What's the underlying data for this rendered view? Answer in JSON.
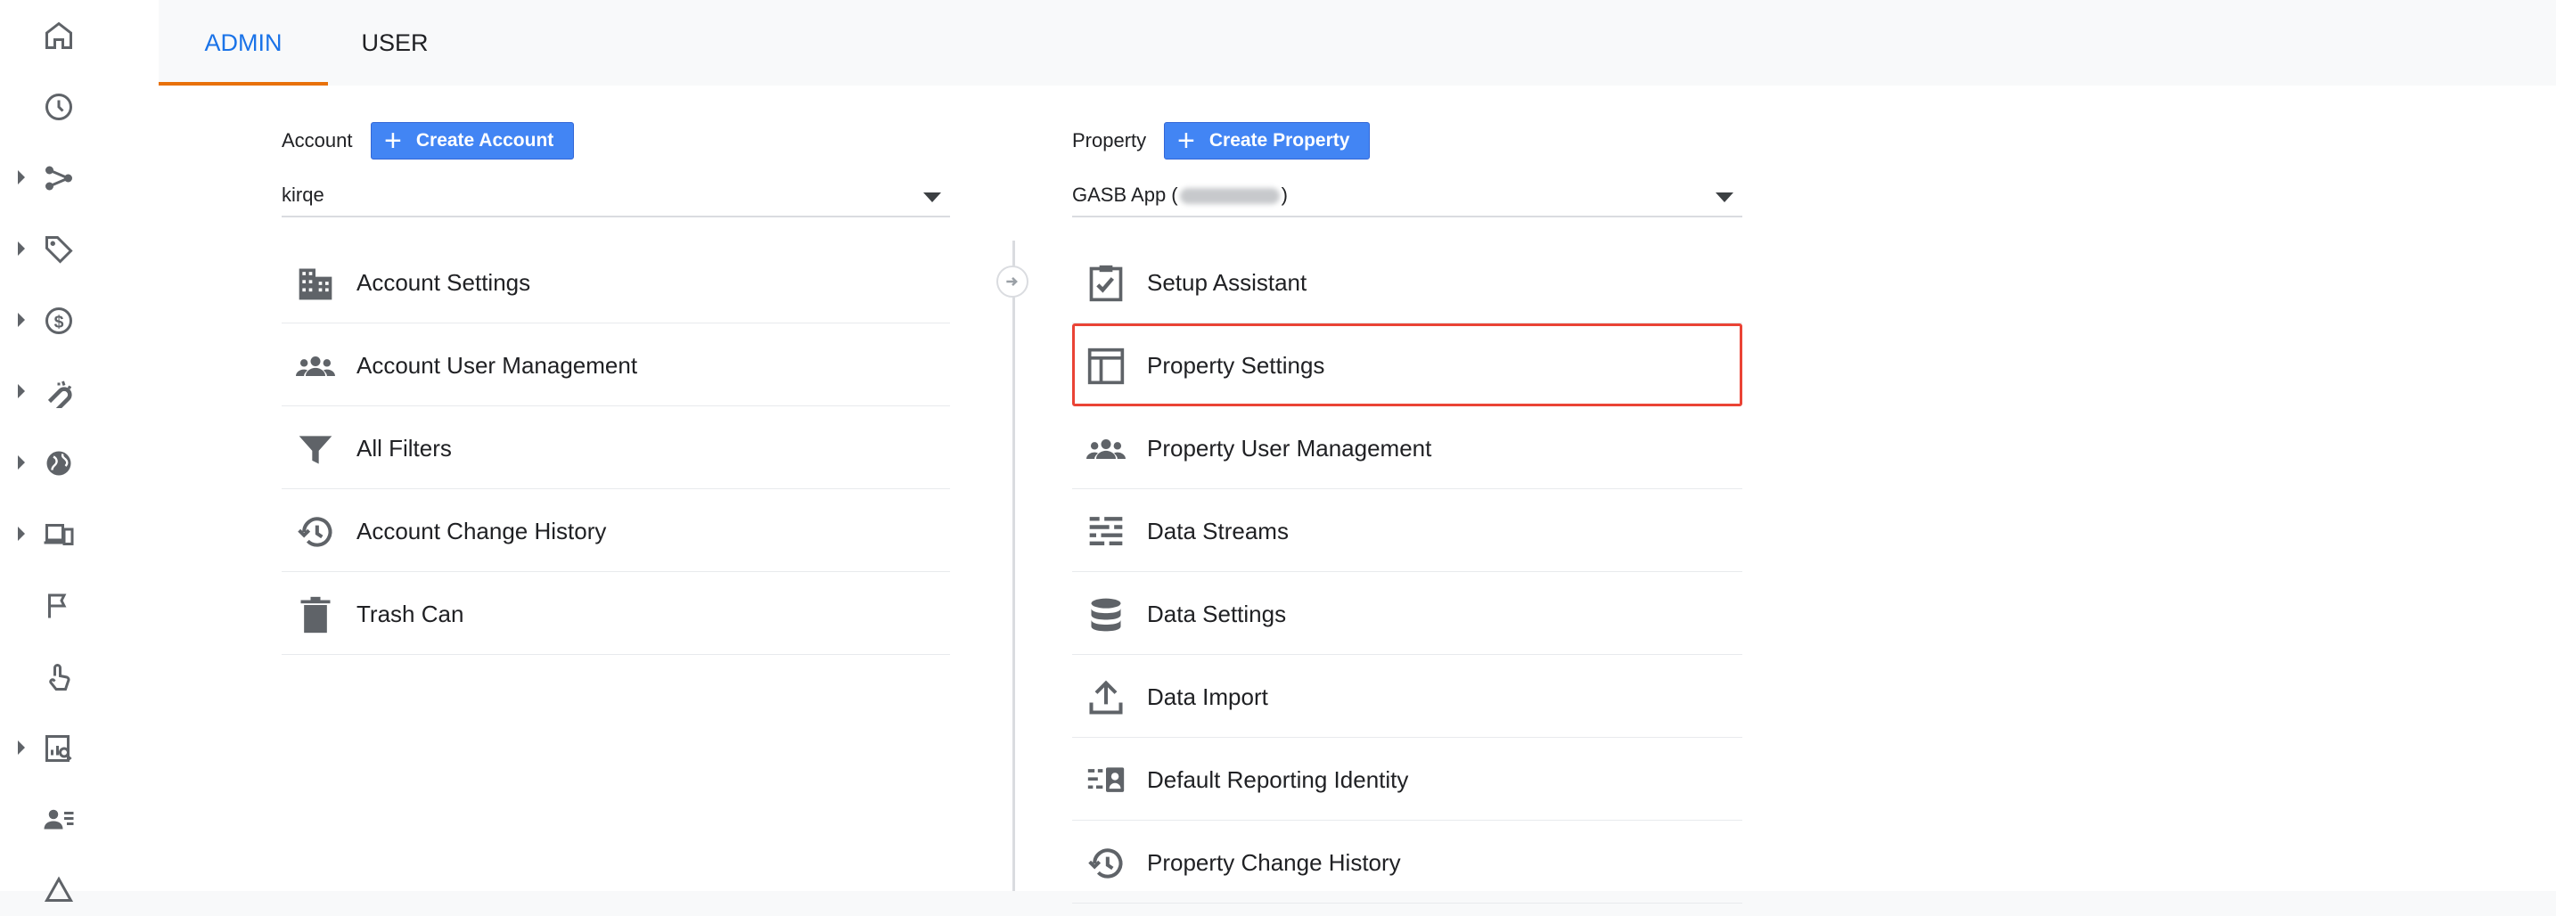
{
  "rail": {
    "items": [
      {
        "icon": "home-icon",
        "expandable": false
      },
      {
        "icon": "clock-icon",
        "expandable": false
      },
      {
        "icon": "flow-icon",
        "expandable": true
      },
      {
        "icon": "tag-icon",
        "expandable": true
      },
      {
        "icon": "dollar-icon",
        "expandable": true
      },
      {
        "icon": "magnet-icon",
        "expandable": true
      },
      {
        "icon": "globe-icon",
        "expandable": true
      },
      {
        "icon": "devices-icon",
        "expandable": true
      },
      {
        "icon": "flag-icon",
        "expandable": false
      },
      {
        "icon": "touch-icon",
        "expandable": false
      },
      {
        "icon": "report-search-icon",
        "expandable": true
      },
      {
        "icon": "person-list-icon",
        "expandable": false
      },
      {
        "icon": "triangle-icon",
        "expandable": false
      }
    ]
  },
  "tabs": {
    "admin": "ADMIN",
    "user": "USER"
  },
  "account": {
    "label": "Account",
    "create_button": "Create Account",
    "selected": "kirqe",
    "menu": [
      {
        "label": "Account Settings",
        "icon": "building-icon"
      },
      {
        "label": "Account User Management",
        "icon": "people-icon"
      },
      {
        "label": "All Filters",
        "icon": "filter-icon"
      },
      {
        "label": "Account Change History",
        "icon": "history-icon"
      },
      {
        "label": "Trash Can",
        "icon": "trash-icon"
      }
    ]
  },
  "property": {
    "label": "Property",
    "create_button": "Create Property",
    "selected_prefix": "GASB App (",
    "selected_suffix": ")",
    "menu": [
      {
        "label": "Setup Assistant",
        "icon": "checklist-icon"
      },
      {
        "label": "Property Settings",
        "icon": "layout-icon",
        "highlighted": true
      },
      {
        "label": "Property User Management",
        "icon": "people-icon"
      },
      {
        "label": "Data Streams",
        "icon": "streams-icon"
      },
      {
        "label": "Data Settings",
        "icon": "database-icon"
      },
      {
        "label": "Data Import",
        "icon": "upload-icon"
      },
      {
        "label": "Default Reporting Identity",
        "icon": "identity-icon"
      },
      {
        "label": "Property Change History",
        "icon": "history-icon"
      }
    ]
  },
  "colors": {
    "accent": "#1a73e8",
    "tab_underline": "#e8710a",
    "button": "#4285f4",
    "highlight_border": "#ea4335",
    "icon": "#5f6368"
  }
}
